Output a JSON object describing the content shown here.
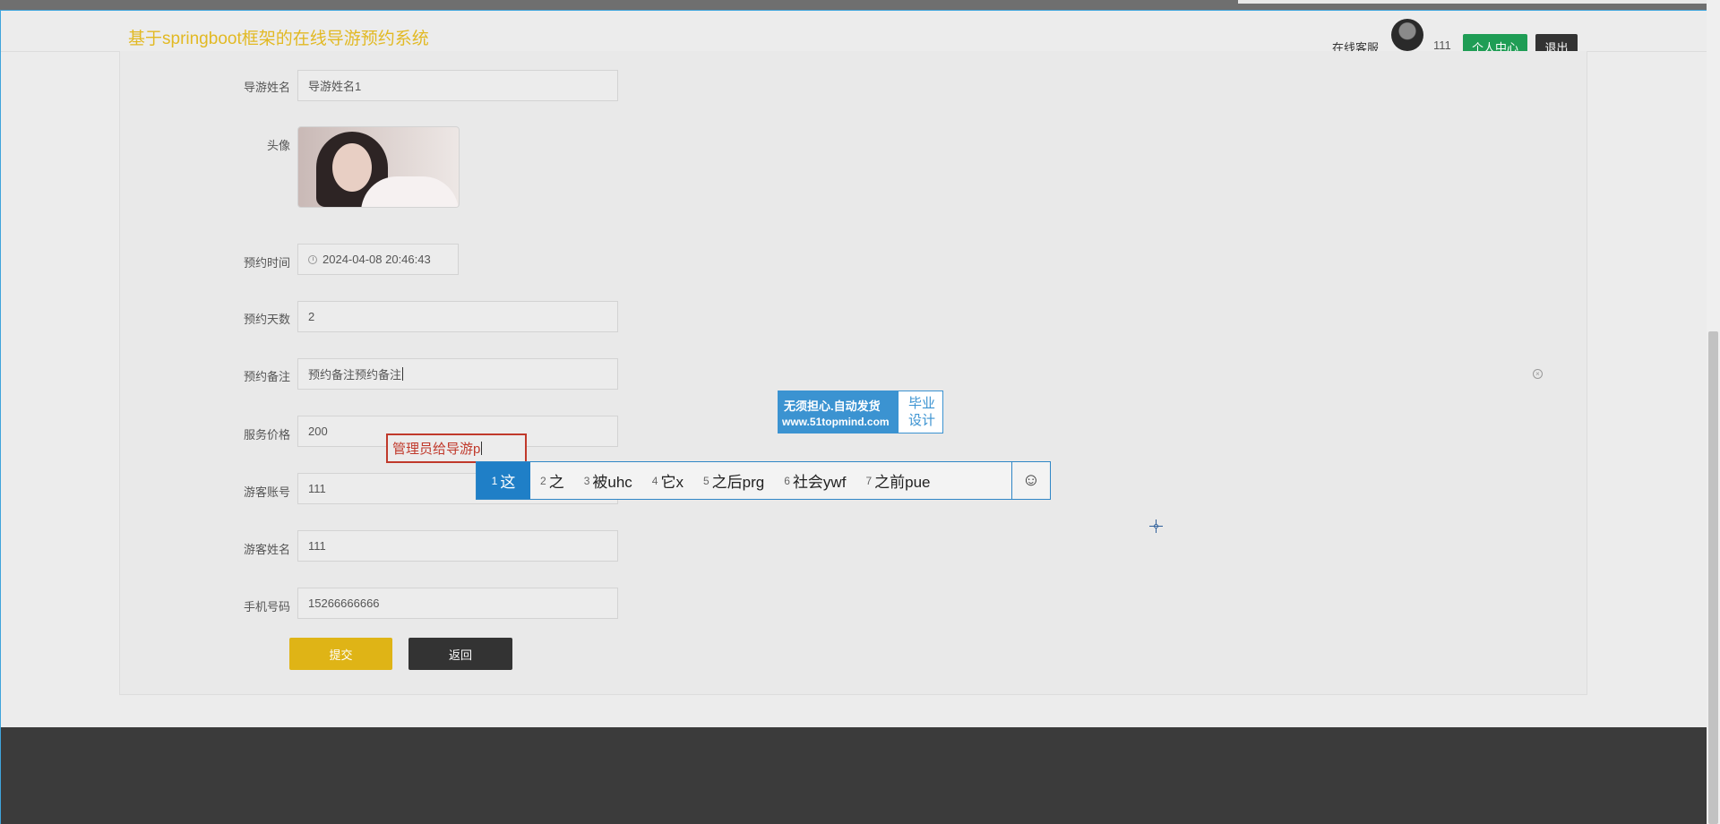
{
  "header": {
    "site_title": "基于springboot框架的在线导游预约系统",
    "online_service": "在线客服",
    "username": "111",
    "personal_center": "个人中心",
    "logout": "退出"
  },
  "form": {
    "guide_name": {
      "label": "导游姓名",
      "value": "导游姓名1"
    },
    "avatar": {
      "label": "头像"
    },
    "booking_time": {
      "label": "预约时间",
      "value": "2024-04-08 20:46:43"
    },
    "booking_days": {
      "label": "预约天数",
      "value": "2"
    },
    "booking_note": {
      "label": "预约备注",
      "value": "预约备注预约备注"
    },
    "service_price": {
      "label": "服务价格",
      "value": "200"
    },
    "visitor_account": {
      "label": "游客账号",
      "value": "111"
    },
    "visitor_name": {
      "label": "游客姓名",
      "value": "111"
    },
    "phone": {
      "label": "手机号码",
      "value": "15266666666"
    },
    "submit": "提交",
    "back": "返回"
  },
  "ime": {
    "composition": "管理员给导游p",
    "candidates": [
      {
        "num": "1",
        "text": "这"
      },
      {
        "num": "2",
        "text": "之"
      },
      {
        "num": "3",
        "text": "被uhc"
      },
      {
        "num": "4",
        "text": "它x"
      },
      {
        "num": "5",
        "text": "之后prg"
      },
      {
        "num": "6",
        "text": "社会ywf"
      },
      {
        "num": "7",
        "text": "之前pue"
      }
    ],
    "emoji_icon": "☺"
  },
  "watermark": {
    "line1": "无须担心.自动发货",
    "line2": "www.51topmind.com",
    "right_line1": "毕业",
    "right_line2": "设计"
  },
  "colors": {
    "title": "#e2b923",
    "personal_center_btn": "#1f9d55",
    "submit_btn": "#dfb416",
    "dark_btn": "#333333",
    "ime_selected": "#1f7fc7",
    "footer": "#3b3b3b"
  }
}
